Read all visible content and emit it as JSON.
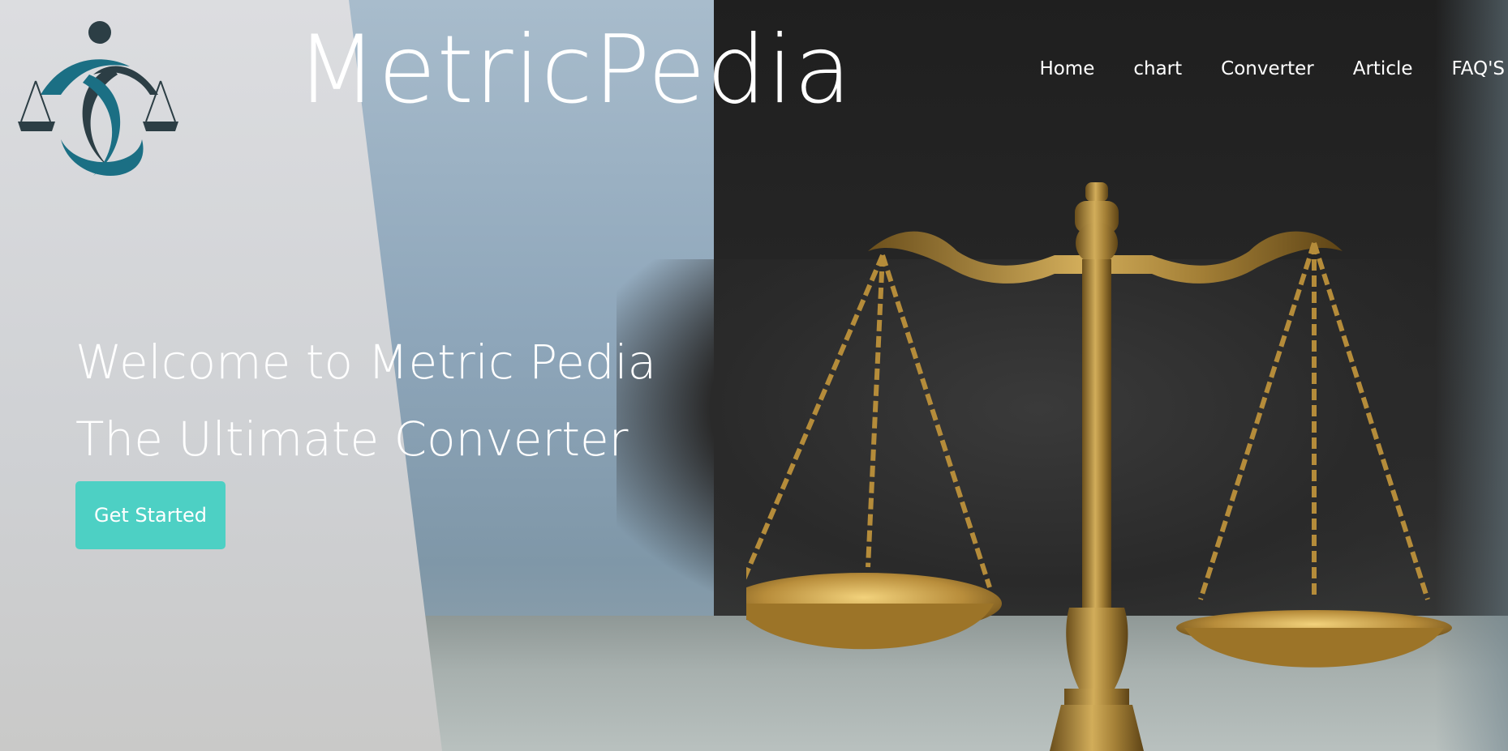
{
  "header": {
    "brand": "MetricPedia",
    "nav": [
      {
        "label": "Home"
      },
      {
        "label": "chart"
      },
      {
        "label": "Converter"
      },
      {
        "label": "Article"
      },
      {
        "label": "FAQ'S"
      }
    ]
  },
  "hero": {
    "line1": "Welcome to Metric Pedia",
    "line2": "The Ultimate Converter",
    "cta_label": "Get Started"
  },
  "colors": {
    "accent": "#4dd0c4",
    "logo_teal": "#1b6f84",
    "logo_dark": "#2c3e45",
    "text": "#ffffff"
  },
  "icons": {
    "logo": "justice-scale-figure-icon",
    "background": "brass-scales-of-justice"
  }
}
